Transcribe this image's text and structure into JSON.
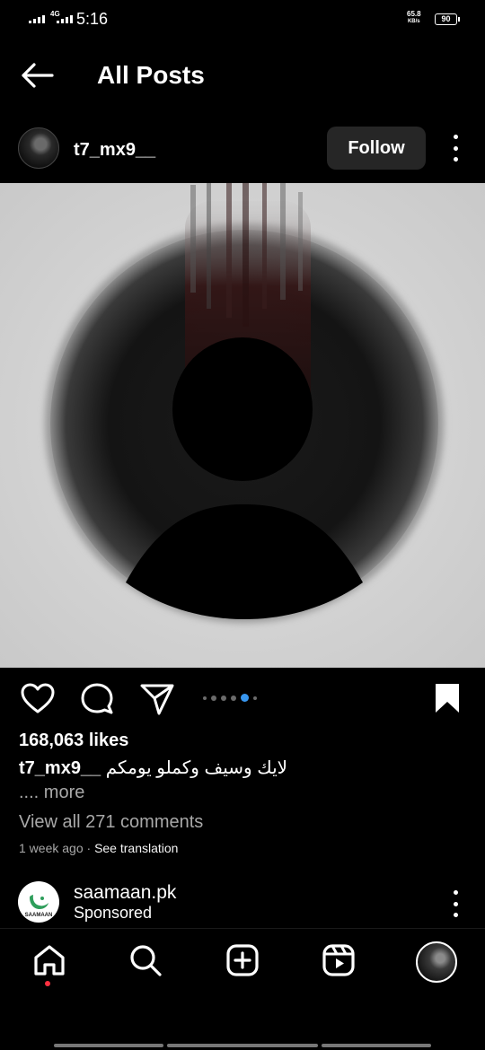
{
  "status_bar": {
    "network": "4G",
    "time": "5:16",
    "speed_value": "65.8",
    "speed_unit": "KB/s",
    "battery": "90"
  },
  "header": {
    "back_icon": "arrow-left-icon",
    "title": "All Posts"
  },
  "post": {
    "username": "t7_mx9__",
    "follow_label": "Follow",
    "likes": "168,063 likes",
    "caption_user": "t7_mx9__",
    "caption_text": "لايك وسيف وكملو يومكم",
    "more_label": ".... more",
    "comments_label": "View all 271 comments",
    "time_ago": "1 week ago",
    "separator": " · ",
    "see_translation": "See translation",
    "carousel": {
      "count": 6,
      "active_index": 4
    }
  },
  "sponsored": {
    "name": "saamaan.pk",
    "label": "Sponsored",
    "logo_text": "SAAMAAN"
  },
  "bottom_nav": {
    "items": [
      "home-icon",
      "search-icon",
      "create-icon",
      "reels-icon",
      "profile-avatar"
    ]
  },
  "colors": {
    "background": "#000000",
    "follow_button": "#262626",
    "active_dot": "#3897f0",
    "notification_dot": "#ff3040",
    "muted_text": "#a8a8a8"
  }
}
